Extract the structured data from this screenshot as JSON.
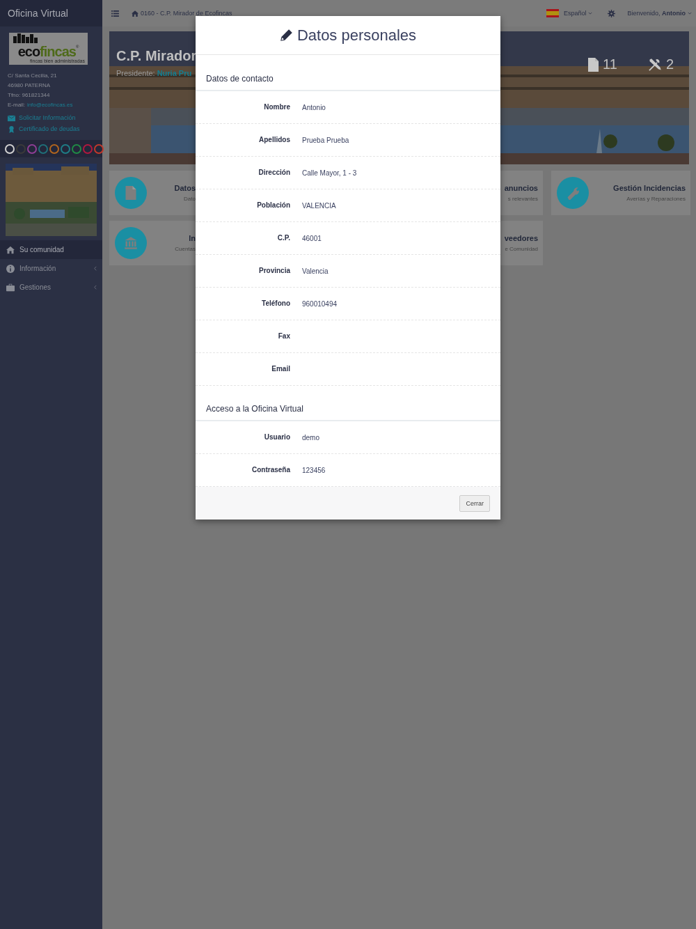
{
  "sidebar": {
    "title": "Oficina Virtual",
    "logo": {
      "eco": "eco",
      "fincas": "fincas",
      "mark": "®",
      "slogan": "fincas bien administradas"
    },
    "address": [
      "C/ Santa Cecilia, 21",
      "46980 PATERNA",
      "Tfno: 961821344"
    ],
    "email_label": "E-mail:",
    "email": "info@ecofincas.es",
    "links": [
      {
        "kind": "mail",
        "label": "Solicitar Información"
      },
      {
        "kind": "award",
        "label": "Certificado de deudas"
      }
    ],
    "themes": [
      {
        "color": "#d0d0d0"
      },
      {
        "color": "#3a3a3a"
      },
      {
        "color": "#8e3e95"
      },
      {
        "color": "#1f6f78"
      },
      {
        "color": "#b0651e"
      },
      {
        "color": "#1e7d86"
      },
      {
        "color": "#1f8a45"
      },
      {
        "color": "#b0183e"
      },
      {
        "color": "#c0392b"
      }
    ],
    "nav": [
      {
        "kind": "home",
        "label": "Su comunidad",
        "selected": true,
        "expandable": false
      },
      {
        "kind": "info",
        "label": "Información",
        "selected": false,
        "expandable": true
      },
      {
        "kind": "briefcase",
        "label": "Gestiones",
        "selected": false,
        "expandable": true
      }
    ]
  },
  "topbar": {
    "breadcrumb": "0160 - C.P. Mirador de Ecofincas",
    "language": "Español",
    "greeting": "Bienvenido, **Antonio**"
  },
  "hero": {
    "title": "C.P. Mirador",
    "president_label": "Presidente:",
    "president": "Nuria Pru",
    "stats": [
      {
        "kind": "document",
        "value": "11"
      },
      {
        "kind": "tools",
        "value": "2"
      }
    ]
  },
  "card_rows": [
    {
      "cards": [
        {
          "kind": "document",
          "title": "Datos",
          "subtitle": "Dato"
        },
        {
          "kind": "plain",
          "title": "anuncios",
          "subtitle": "s relevantes"
        },
        {
          "kind": "wrench",
          "title": "Gestión Incidencias",
          "subtitle": "Averías y Reparaciones"
        }
      ]
    },
    {
      "cards": [
        {
          "kind": "bank",
          "title": "In",
          "subtitle": "Cuentas"
        },
        {
          "kind": "plain",
          "title": "veedores",
          "subtitle": "e Comunidad"
        }
      ]
    }
  ],
  "modal": {
    "title": "Datos personales",
    "sections": [
      {
        "heading": "Datos de contacto",
        "fields": [
          {
            "label": "Nombre",
            "value": "Antonio"
          },
          {
            "label": "Apellidos",
            "value": "Prueba Prueba"
          },
          {
            "label": "Dirección",
            "value": "Calle Mayor, 1 - 3"
          },
          {
            "label": "Población",
            "value": "VALENCIA"
          },
          {
            "label": "C.P.",
            "value": "46001"
          },
          {
            "label": "Provincia",
            "value": "Valencia"
          },
          {
            "label": "Teléfono",
            "value": "960010494"
          },
          {
            "label": "Fax"
          },
          {
            "label": "Email"
          }
        ]
      },
      {
        "heading": "Acceso a la Oficina Virtual",
        "fields": [
          {
            "label": "Usuario",
            "value": "demo"
          },
          {
            "label": "Contraseña",
            "value": "123456"
          }
        ]
      }
    ],
    "close_button": "Cerrar"
  }
}
